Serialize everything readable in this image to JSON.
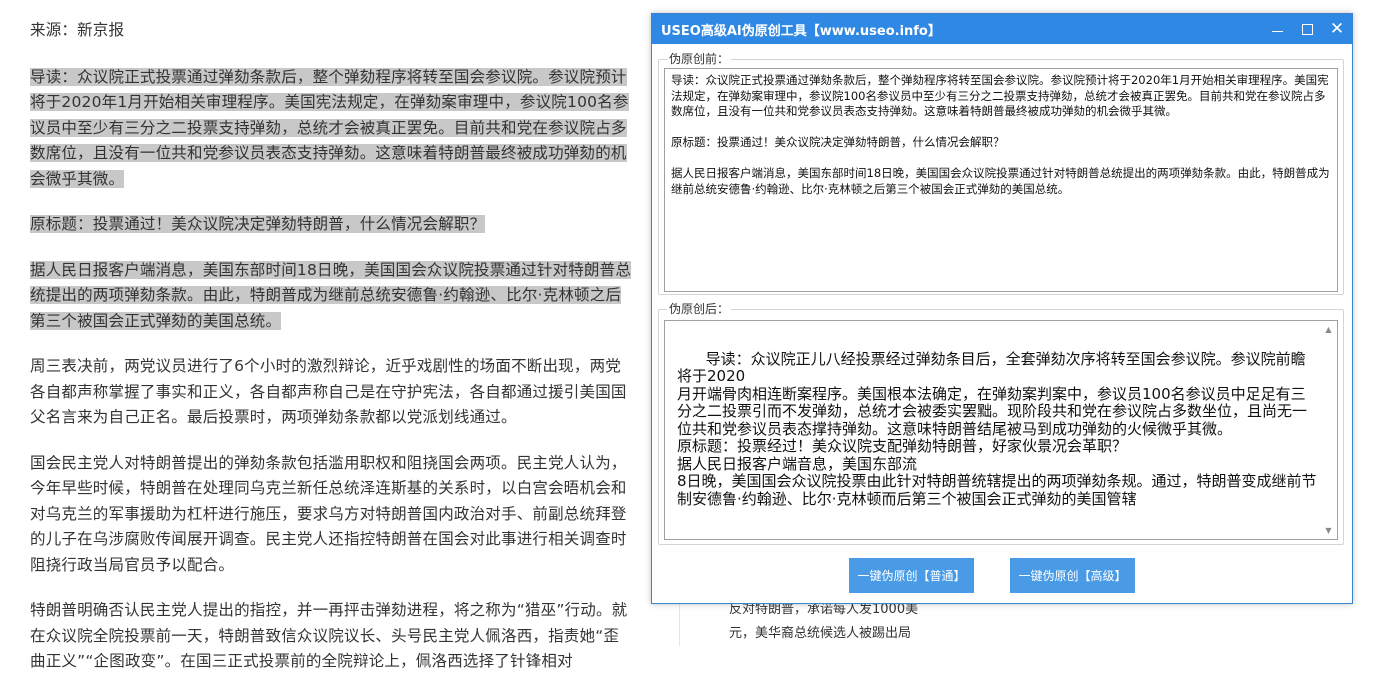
{
  "article": {
    "source": "来源：新京报",
    "paragraphs": [
      {
        "text": "导读：众议院正式投票通过弹劾条款后，整个弹劾程序将转至国会参议院。参议院预计将于2020年1月开始相关审理程序。美国宪法规定，在弹劾案审理中，参议院100名参议员中至少有三分之二投票支持弹劾，总统才会被真正罢免。目前共和党在参议院占多数席位，且没有一位共和党参议员表态支持弹劾。这意味着特朗普最终被成功弹劾的机会微乎其微。",
        "selected": true
      },
      {
        "text": "原标题：投票通过！美众议院决定弹劾特朗普，什么情况会解职？",
        "selected": true
      },
      {
        "text": "据人民日报客户端消息，美国东部时间18日晚，美国国会众议院投票通过针对特朗普总统提出的两项弹劾条款。由此，特朗普成为继前总统安德鲁·约翰逊、比尔·克林顿之后第三个被国会正式弹劾的美国总统。",
        "selected": true
      },
      {
        "text": "周三表决前，两党议员进行了6个小时的激烈辩论，近乎戏剧性的场面不断出现，两党各自都声称掌握了事实和正义，各自都声称自己是在守护宪法，各自都通过援引美国国父名言来为自己正名。最后投票时，两项弹劾条款都以党派划线通过。",
        "selected": false
      },
      {
        "text": "国会民主党人对特朗普提出的弹劾条款包括滥用职权和阻挠国会两项。民主党人认为，今年早些时候，特朗普在处理同乌克兰新任总统泽连斯基的关系时，以白宫会晤机会和对乌克兰的军事援助为杠杆进行施压，要求乌方对特朗普国内政治对手、前副总统拜登的儿子在乌涉腐败传闻展开调查。民主党人还指控特朗普在国会对此事进行相关调查时阻挠行政当局官员予以配合。",
        "selected": false
      },
      {
        "text": "特朗普明确否认民主党人提出的指控，并一再抨击弹劾进程，将之称为“猎巫”行动。就在众议院全院投票前一天，特朗普致信众议院议长、头号民主党人佩洛西，指责她“歪曲正义”“企图政变”。在国三正式投票前的全院辩论上，佩洛西选择了针锋相对",
        "selected": false
      }
    ]
  },
  "side_fragment": {
    "line1": "反对特朗普，承诺每人发1000美",
    "line2": "元，美华裔总统候选人被踢出局"
  },
  "window": {
    "title": "USEO高级AI伪原创工具【www.useo.info】",
    "controls": {
      "minimize": "minimize",
      "maximize": "maximize",
      "close": "✕"
    },
    "before_label": "伪原创前：",
    "before_text": "导读：众议院正式投票通过弹劾条款后，整个弹劾程序将转至国会参议院。参议院预计将于2020年1月开始相关审理程序。美国宪法规定，在弹劾案审理中，参议院100名参议员中至少有三分之二投票支持弹劾，总统才会被真正罢免。目前共和党在参议院占多数席位，且没有一位共和党参议员表态支持弹劾。这意味着特朗普最终被成功弹劾的机会微乎其微。\n\n原标题：投票通过！美众议院决定弹劾特朗普，什么情况会解职？\n\n据人民日报客户端消息，美国东部时间18日晚，美国国会众议院投票通过针对特朗普总统提出的两项弹劾条款。由此，特朗普成为继前总统安德鲁·约翰逊、比尔·克林顿之后第三个被国会正式弹劾的美国总统。",
    "after_label": "伪原创后：",
    "after_text": "导读：众议院正儿八经投票经过弹劾条目后，全套弹劾次序将转至国会参议院。参议院前瞻将于2020\n月开端骨肉相连断案程序。美国根本法确定，在弹劾案判案中，参议员100名参议员中足足有三分之二投票引而不发弹劾，总统才会被委实罢黜。现阶段共和党在参议院占多数坐位，且尚无一位共和党参议员表态撑持弹劾。这意味特朗普结尾被马到成功弹劾的火候微乎其微。\n原标题：投票经过！美众议院支配弹劾特朗普，好家伙景况会革职？\n据人民日报客户端音息，美国东部流\n8日晚，美国国会众议院投票由此针对特朗普统辖提出的两项弹劾条规。通过，特朗普变成继前节制安德鲁·约翰逊、比尔·克林顿而后第三个被国会正式弹劾的美国管辖",
    "button_normal": "一键伪原创【普通】",
    "button_advanced": "一键伪原创【高级】"
  }
}
